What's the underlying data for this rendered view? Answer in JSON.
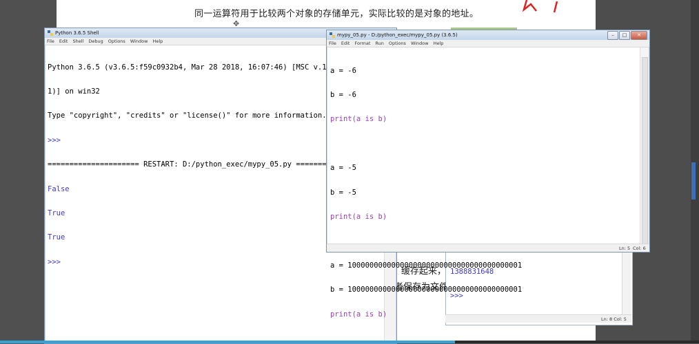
{
  "doc": {
    "heading": "同一运算符用于比较两个对象的存储单元，实际比较的是对象的地址。",
    "cursor_glyph": "✥",
    "fragment_1": "缓存起来，",
    "fragment_2": "者保存为文件"
  },
  "shell": {
    "title": "Python 3.6.5 Shell",
    "menu": [
      "File",
      "Edit",
      "Shell",
      "Debug",
      "Options",
      "Window",
      "Help"
    ],
    "lines": [
      "Python 3.6.5 (v3.6.5:f59c0932b4, Mar 28 2018, 16:07:46) [MSC v.1900",
      "1)] on win32",
      "Type \"copyright\", \"credits\" or \"license()\" for more information.",
      ">>> ",
      "===================== RESTART: D:/python_exec/mypy_05.py ==========",
      "False",
      "True",
      "True",
      ">>> "
    ]
  },
  "editor": {
    "title": "mypy_05.py - D:/python_exec/mypy_05.py (3.6.5)",
    "menu": [
      "File",
      "Edit",
      "Format",
      "Run",
      "Options",
      "Window",
      "Help"
    ],
    "code": [
      "a = -6",
      "b = -6",
      "print(a is b)",
      "",
      "a = -5",
      "b = -5",
      "print(a is b)",
      "",
      "a = 1000000000000000000000000000000000000001",
      "b = 1000000000000000000000000000000000000001",
      "print(a is b)"
    ],
    "status_ln": "Ln: 5",
    "status_col": "Col: 6"
  },
  "back_shell": {
    "lines": [
      "1388831648",
      ">>> "
    ],
    "status": "Ln: 8  Col: 5"
  },
  "colors": {
    "prompt": "#3b3bd0",
    "keyword": "#9b3fb5",
    "string": "#c0392b"
  }
}
